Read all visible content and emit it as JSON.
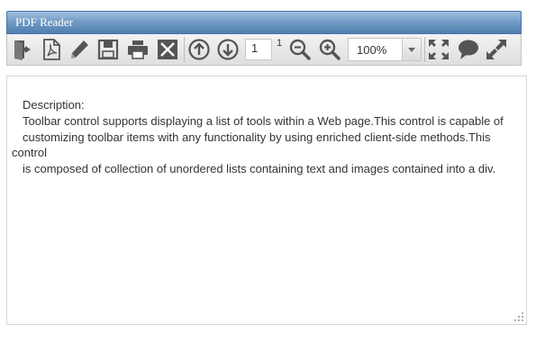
{
  "window": {
    "title": "PDF Reader"
  },
  "toolbar": {
    "tools": [
      {
        "name": "open-icon"
      },
      {
        "name": "pdf-icon"
      },
      {
        "name": "edit-pencil-icon"
      },
      {
        "name": "save-icon"
      },
      {
        "name": "print-icon"
      },
      {
        "name": "close-document-icon"
      },
      {
        "name": "previous-page-icon"
      },
      {
        "name": "next-page-icon"
      },
      {
        "name": "zoom-out-icon"
      },
      {
        "name": "zoom-in-icon"
      },
      {
        "name": "fit-page-icon"
      },
      {
        "name": "comment-icon"
      },
      {
        "name": "fullscreen-icon"
      }
    ],
    "page_value": "1",
    "page_total": "1",
    "zoom_value": "100%"
  },
  "content": {
    "lines": [
      "Description:",
      "Toolbar control supports displaying a list of tools within a Web page.This control is capable of",
      "customizing toolbar items with any functionality by using enriched client-side methods.This",
      "control",
      "is composed of collection of unordered lists containing text and images contained into a div."
    ]
  },
  "colors": {
    "titlebar": "#6f99c3",
    "icon": "#555555"
  }
}
